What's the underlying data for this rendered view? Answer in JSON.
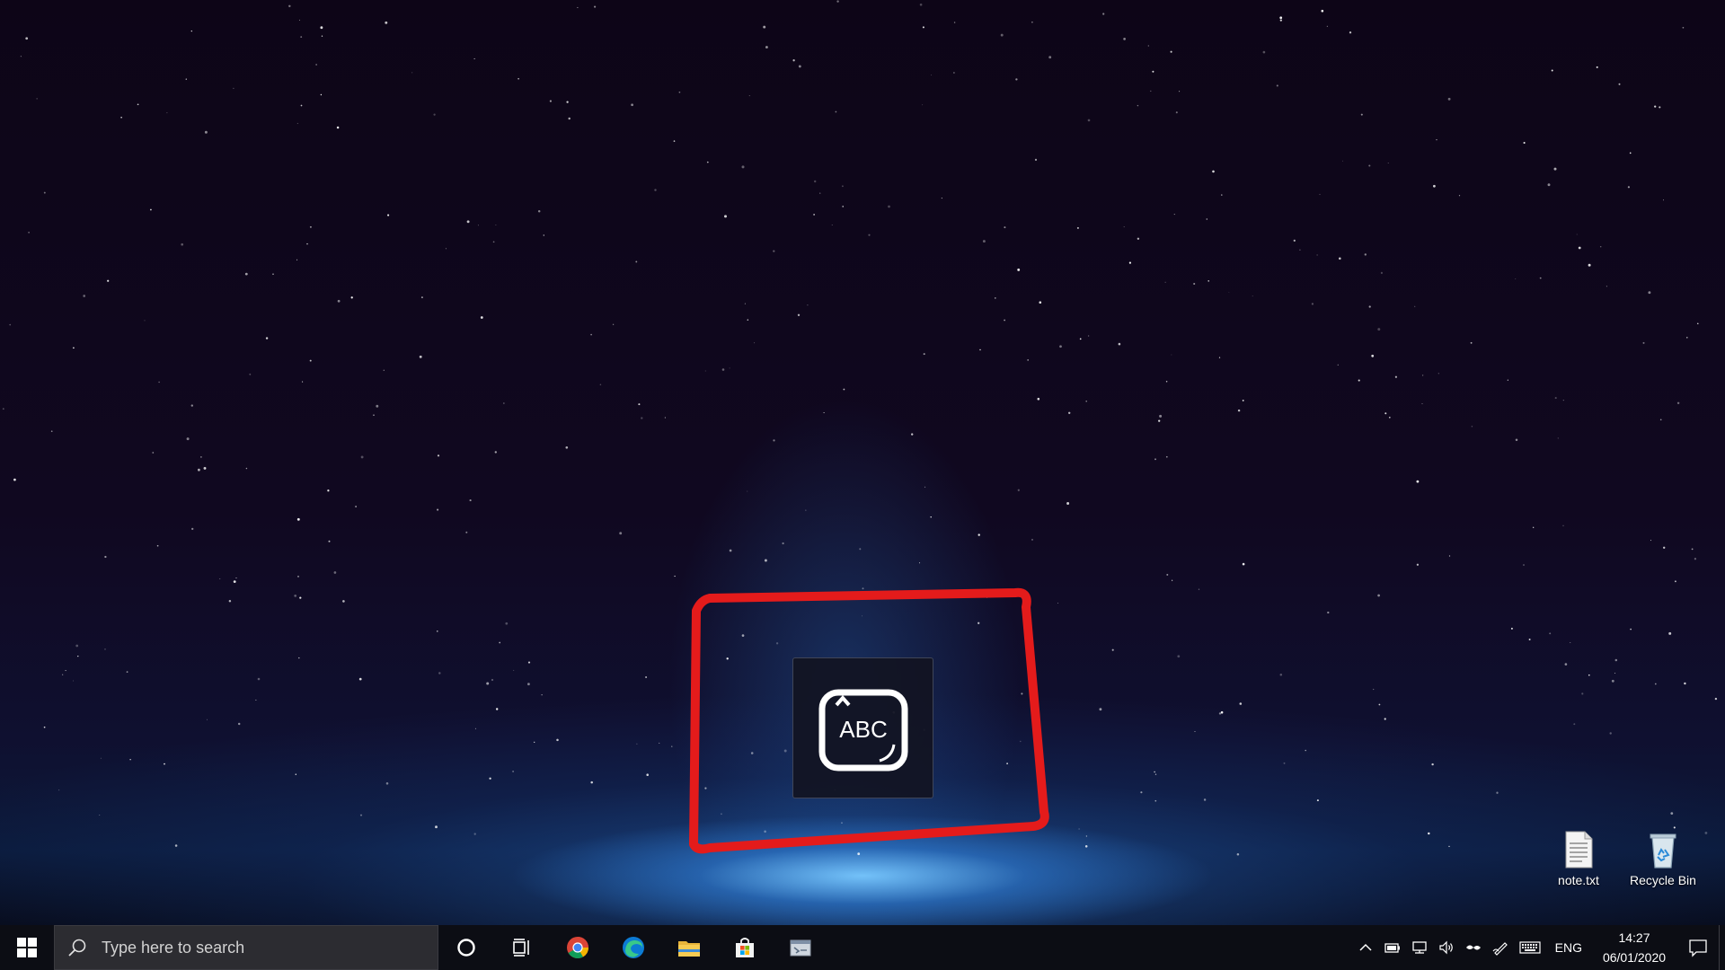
{
  "desktop": {
    "icons": [
      {
        "label": "note.txt",
        "icon": "text-file-icon"
      },
      {
        "label": "Recycle Bin",
        "icon": "recycle-bin-icon"
      }
    ],
    "ime_popup": {
      "text": "ABC",
      "icon": "ime-mode-icon"
    },
    "annotation_color": "#e41b1b"
  },
  "taskbar": {
    "search": {
      "placeholder": "Type here to search"
    },
    "apps": [
      {
        "name": "cortana",
        "icon": "cortana-icon"
      },
      {
        "name": "task-view",
        "icon": "task-view-icon"
      },
      {
        "name": "chrome",
        "icon": "chrome-icon"
      },
      {
        "name": "edge",
        "icon": "edge-icon"
      },
      {
        "name": "file-explorer",
        "icon": "folder-icon"
      },
      {
        "name": "store",
        "icon": "store-icon"
      },
      {
        "name": "remote-app",
        "icon": "app-window-icon"
      }
    ],
    "tray": {
      "language": "ENG",
      "time": "14:27",
      "date": "06/01/2020"
    }
  }
}
